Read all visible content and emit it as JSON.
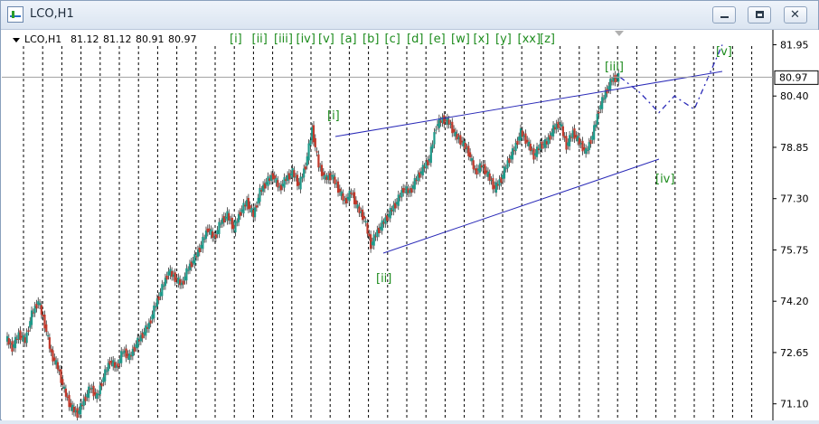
{
  "window": {
    "title": "LCO,H1"
  },
  "chart": {
    "symbol_caption": "LCO,H1",
    "ohlc": {
      "open": "81.12",
      "high": "81.12",
      "low": "80.91",
      "close": "80.97"
    },
    "current_price_label": "80.97",
    "price_axis": [
      "81.95",
      "80.40",
      "78.85",
      "77.30",
      "75.75",
      "74.20",
      "72.65",
      "71.10"
    ],
    "wave_labels": [
      "[i]",
      "[ii]",
      "[iii]",
      "[iv]",
      "[v]"
    ],
    "top_markers": [
      "[i]",
      "[ii]",
      "[iii]",
      "[iv]",
      "[v]",
      "[a]",
      "[b]",
      "[c]",
      "[d]",
      "[e]",
      "[w]",
      "[x]",
      "[y]",
      "[xx]",
      "[z]"
    ],
    "colors": {
      "bull": "#1f9a8a",
      "bear": "#c0392b",
      "channel": "#2b2bb8",
      "wave_label": "#1e8c1e",
      "grid": "#000000"
    }
  },
  "chart_data": {
    "type": "line",
    "ylim": [
      70.6,
      82.4
    ],
    "series": [
      {
        "values": [
          73.1,
          72.8,
          73.2,
          73.0,
          73.8,
          74.2,
          73.5,
          72.6,
          72.2,
          71.5,
          71.0,
          70.8,
          71.2,
          71.6,
          71.3,
          71.9,
          72.4,
          72.2,
          72.7,
          72.5,
          72.9,
          73.2,
          73.5,
          74.1,
          74.6,
          75.1,
          74.9,
          74.7,
          75.2,
          75.5,
          75.9,
          76.4,
          76.1,
          76.6,
          76.8,
          76.4,
          76.9,
          77.2,
          76.8,
          77.5,
          77.8,
          78.0,
          77.6,
          77.9,
          78.1,
          77.7,
          78.3,
          79.4,
          78.3,
          77.9,
          78.0,
          77.6,
          77.2,
          77.5,
          77.0,
          76.7,
          75.9,
          76.3,
          76.6,
          76.9,
          77.2,
          77.6,
          77.5,
          77.9,
          78.2,
          78.5,
          79.5,
          79.7,
          79.6,
          79.2,
          79.0,
          78.7,
          78.1,
          78.3,
          78.0,
          77.6,
          77.9,
          78.4,
          78.8,
          79.3,
          79.0,
          78.6,
          78.9,
          79.0,
          79.4,
          79.6,
          78.9,
          79.3,
          79.0,
          78.7,
          79.2,
          80.0,
          80.5,
          80.9,
          80.97
        ]
      }
    ],
    "projection": {
      "values": [
        80.97,
        80.5,
        79.9,
        80.4,
        80.0,
        81.95
      ]
    }
  }
}
